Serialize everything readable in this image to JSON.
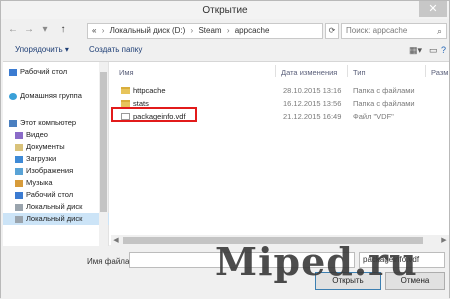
{
  "window": {
    "title": "Открытие",
    "close_glyph": "✕"
  },
  "nav": {
    "back": "←",
    "forward": "→",
    "recent": "▾",
    "up": "↑",
    "breadcrumb": [
      "«",
      "Локальный диск (D:)",
      "Steam",
      "appcache"
    ],
    "search_placeholder": "Поиск: appcache"
  },
  "toolbar": {
    "organize": "Упорядочить ▾",
    "new_folder": "Создать папку"
  },
  "sidebar": [
    {
      "label": "Рабочий стол",
      "icon": "desktop-icon"
    },
    {
      "label": "Домашняя группа",
      "icon": "homegroup-icon"
    },
    {
      "label": "Этот компьютер",
      "icon": "computer-icon"
    },
    {
      "label": "Видео",
      "icon": "video-icon"
    },
    {
      "label": "Документы",
      "icon": "documents-icon"
    },
    {
      "label": "Загрузки",
      "icon": "downloads-icon"
    },
    {
      "label": "Изображения",
      "icon": "pictures-icon"
    },
    {
      "label": "Музыка",
      "icon": "music-icon"
    },
    {
      "label": "Рабочий стол",
      "icon": "desktop-icon"
    },
    {
      "label": "Локальный диск",
      "icon": "drive-icon"
    },
    {
      "label": "Локальный диск",
      "icon": "drive-icon"
    }
  ],
  "columns": [
    "Имя",
    "Дата изменения",
    "Тип",
    "Разм"
  ],
  "files": [
    {
      "name": "httpcache",
      "date": "28.10.2015 13:16",
      "type": "Папка с файлами",
      "kind": "folder"
    },
    {
      "name": "stats",
      "date": "16.12.2015 13:56",
      "type": "Папка с файлами",
      "kind": "folder"
    },
    {
      "name": "packageinfo.vdf",
      "date": "21.12.2015 16:49",
      "type": "Файл \"VDF\"",
      "kind": "file"
    }
  ],
  "bottom": {
    "filename_label": "Имя файла:",
    "filename_value": "",
    "filter_value": "packageinfo.vdf",
    "open": "Открыть",
    "cancel": "Отмена"
  },
  "watermark": "Miped.ru",
  "colors": {
    "highlight": "#e21b1b",
    "folder": "#e7c45b",
    "selection": "#cce4f7"
  }
}
